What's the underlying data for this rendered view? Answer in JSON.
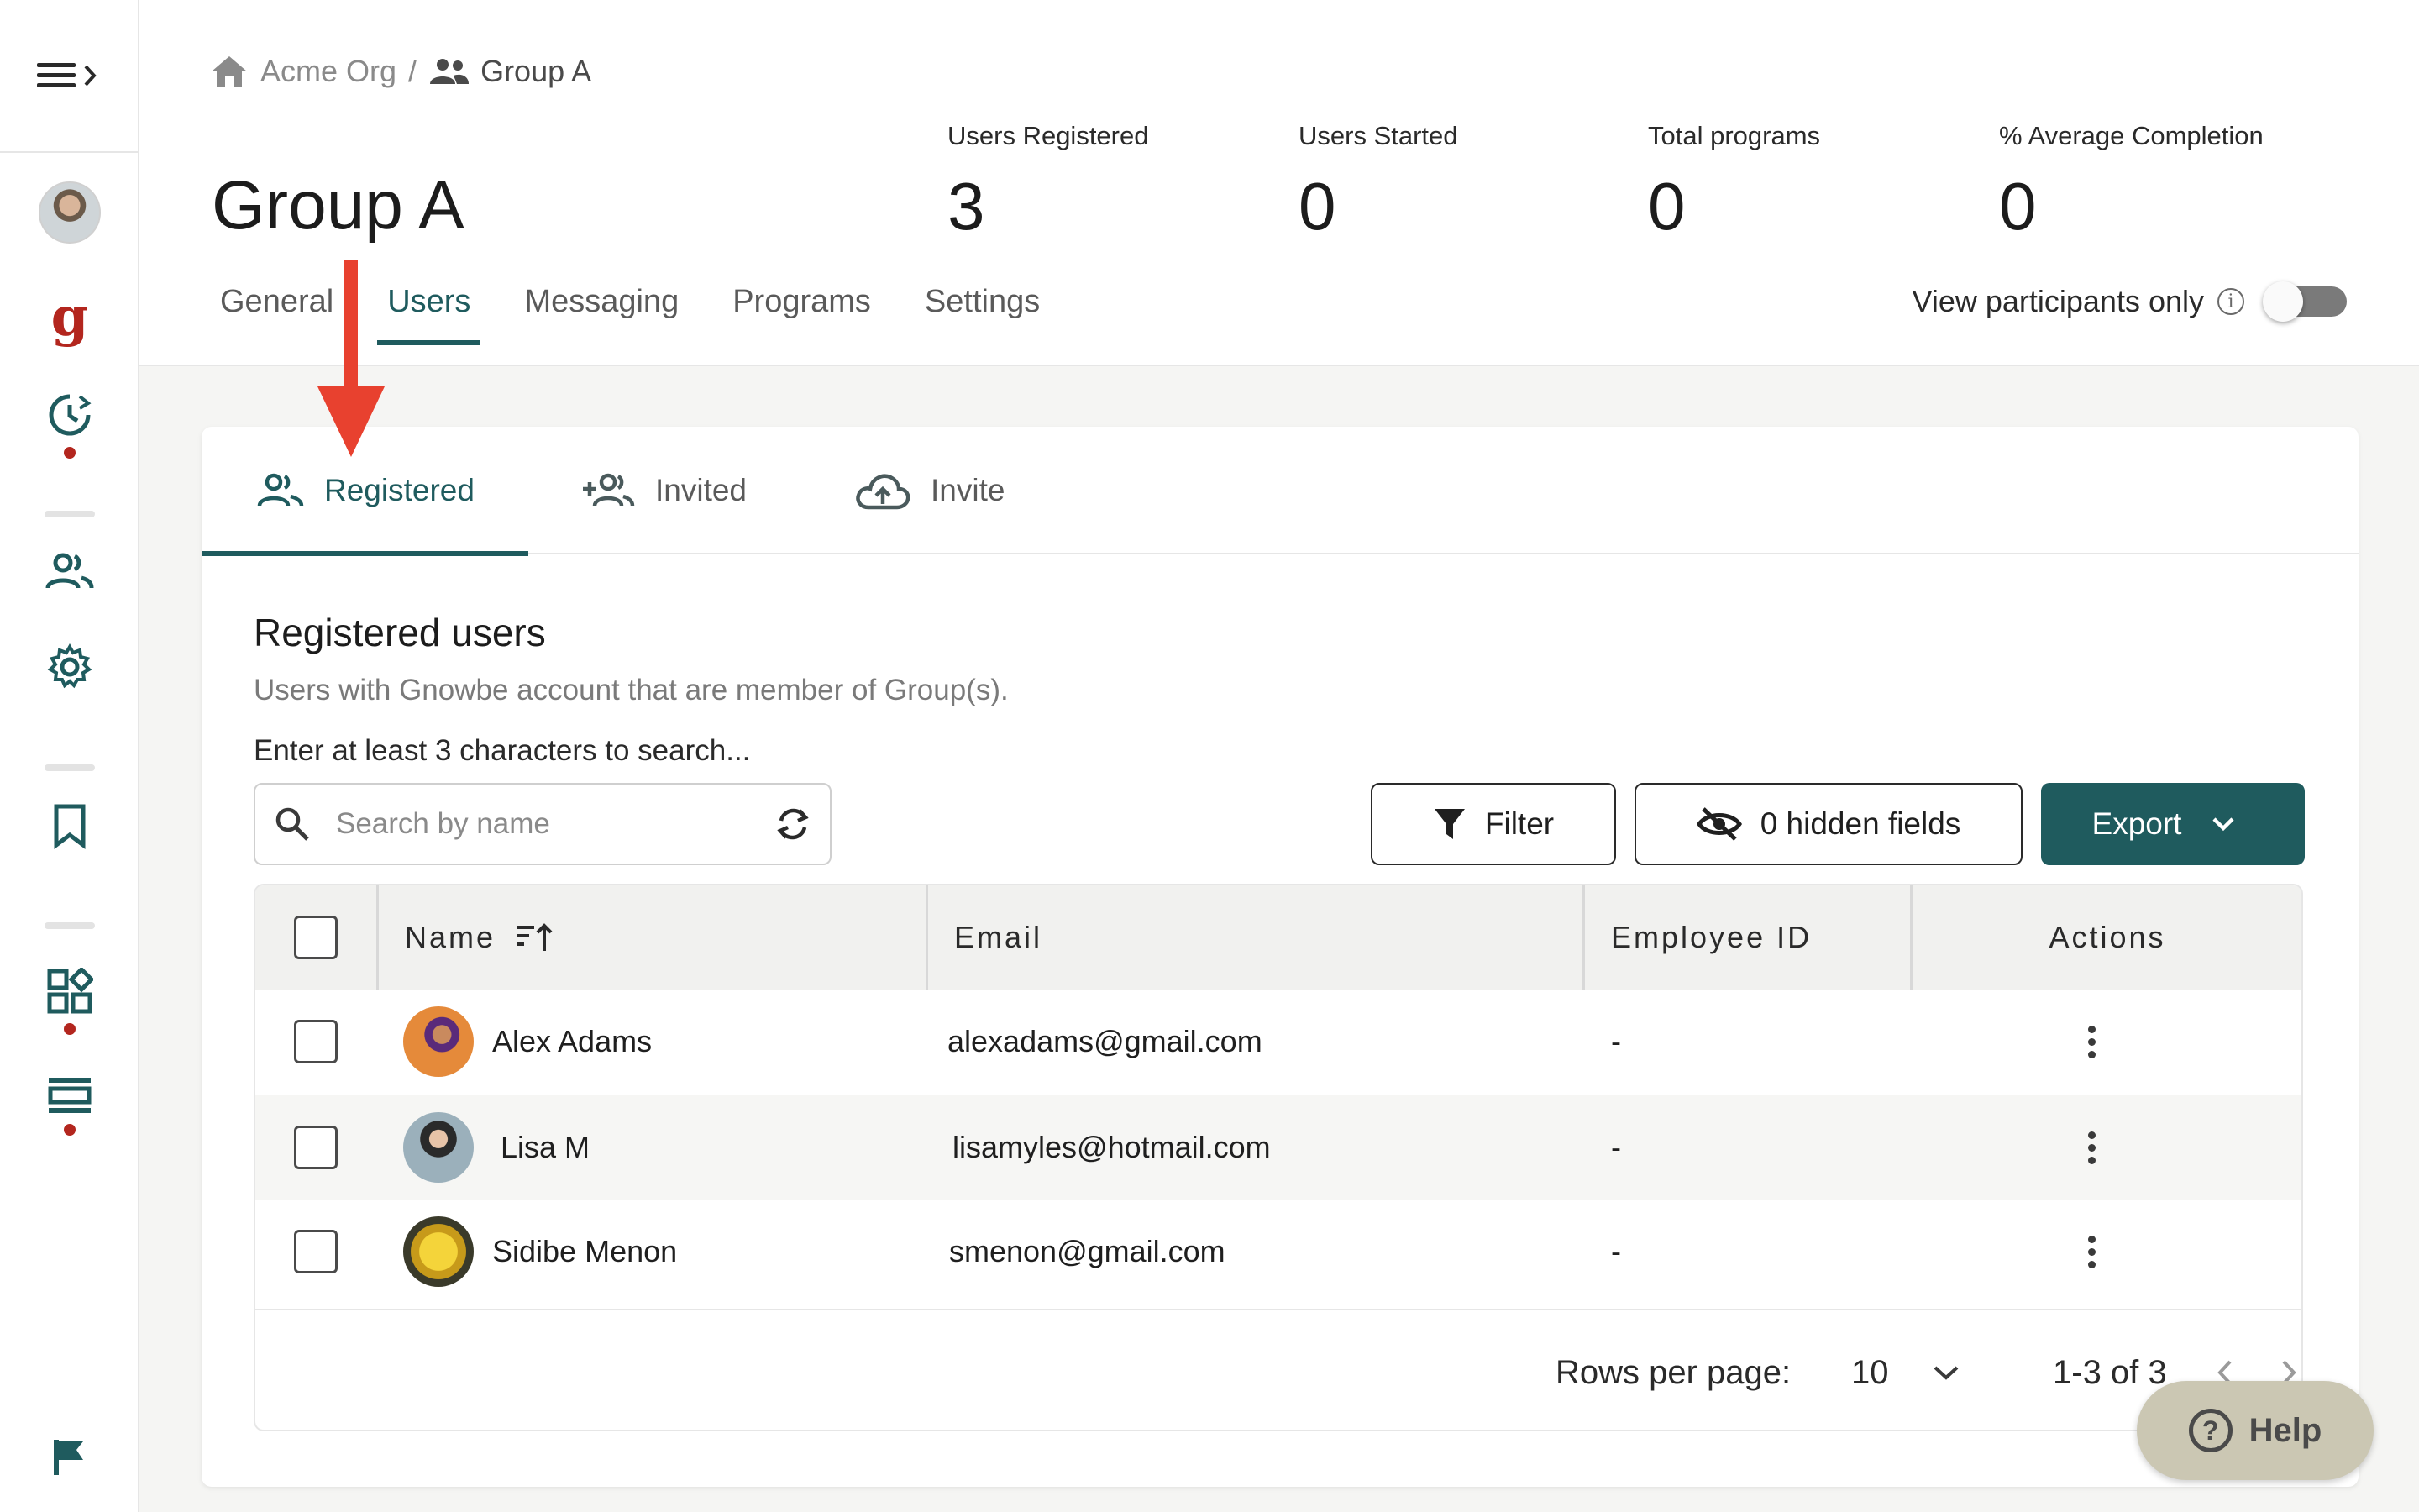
{
  "breadcrumb": {
    "org": "Acme Org",
    "separator": "/",
    "group": "Group A"
  },
  "page_title": "Group A",
  "stats": [
    {
      "label": "Users Registered",
      "value": "3"
    },
    {
      "label": "Users Started",
      "value": "0"
    },
    {
      "label": "Total programs",
      "value": "0"
    },
    {
      "label": "% Average Completion",
      "value": "0"
    }
  ],
  "tabs": [
    "General",
    "Users",
    "Messaging",
    "Programs",
    "Settings"
  ],
  "active_tab": "Users",
  "view_participants": {
    "label": "View participants only",
    "enabled": false
  },
  "subtabs": [
    {
      "label": "Registered",
      "icon": "users-icon"
    },
    {
      "label": "Invited",
      "icon": "add-users-icon"
    },
    {
      "label": "Invite",
      "icon": "cloud-upload-icon"
    }
  ],
  "section": {
    "title": "Registered users",
    "subtitle": "Users with Gnowbe account that are member of Group(s).",
    "search_hint": "Enter at least 3 characters to search...",
    "search_placeholder": "Search by name"
  },
  "buttons": {
    "filter": "Filter",
    "hidden_fields": "0 hidden fields",
    "export": "Export"
  },
  "table": {
    "headers": {
      "name": "Name",
      "email": "Email",
      "employee_id": "Employee ID",
      "actions": "Actions"
    },
    "rows": [
      {
        "name": "Alex Adams",
        "email": "alexadams@gmail.com",
        "employee_id": "-"
      },
      {
        "name": "Lisa M",
        "email": "lisamyles@hotmail.com",
        "employee_id": "-"
      },
      {
        "name": "Sidibe Menon",
        "email": "smenon@gmail.com",
        "employee_id": "-"
      }
    ]
  },
  "pagination": {
    "rows_per_page_label": "Rows per page:",
    "rows_per_page": "10",
    "range": "1-3 of 3"
  },
  "help": {
    "label": "Help"
  },
  "colors": {
    "accent": "#1f5b5e",
    "brand_red": "#b3261e",
    "annotation_arrow": "#e8412f"
  }
}
